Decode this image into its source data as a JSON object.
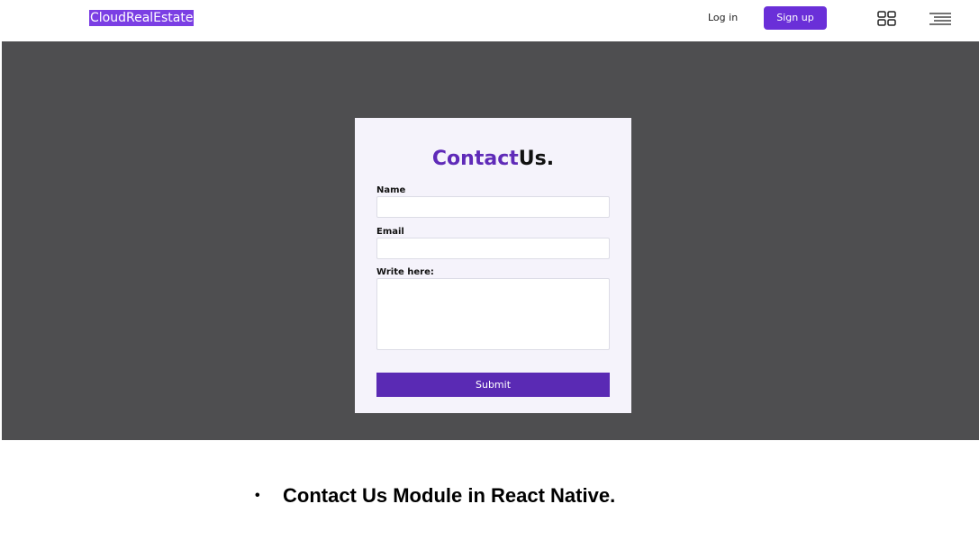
{
  "navbar": {
    "brand": "CloudRealEstate",
    "login_label": "Log in",
    "signup_label": "Sign up",
    "icons": [
      "grid-icon",
      "menu-icon"
    ]
  },
  "contact_form": {
    "title_part1": "Contact",
    "title_part2": "Us.",
    "name_label": "Name",
    "name_value": "",
    "email_label": "Email",
    "email_value": "",
    "message_label": "Write here:",
    "message_value": "",
    "submit_label": "Submit"
  },
  "caption": {
    "bullet": "•",
    "text": "Contact Us Module in React Native."
  },
  "colors": {
    "accent": "#6a2fd8",
    "brand_bg": "#7b3fe4",
    "hero_bg": "#4e4e50",
    "card_bg": "#f5f3fb",
    "submit_bg": "#5a2ab4"
  }
}
